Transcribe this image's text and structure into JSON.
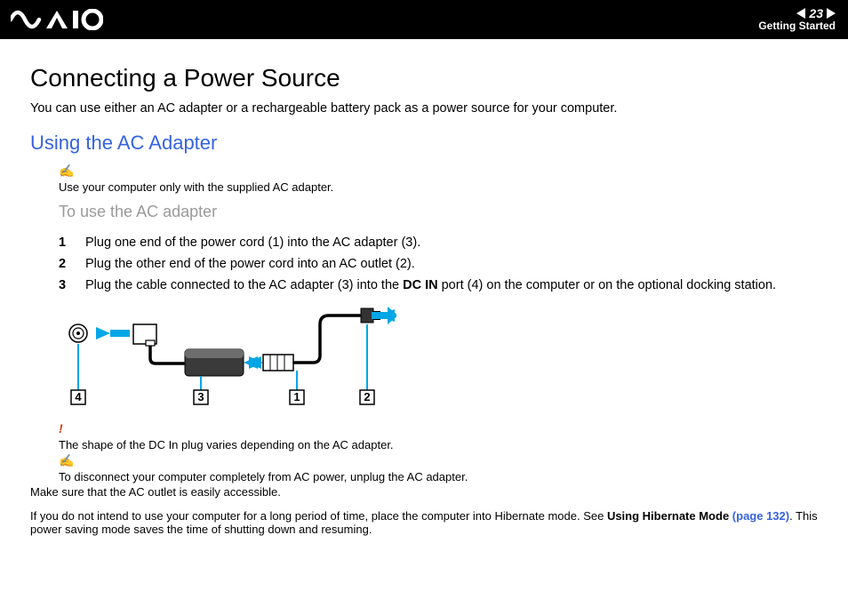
{
  "header": {
    "page_number": "23",
    "section": "Getting Started"
  },
  "title": "Connecting a Power Source",
  "intro": "You can use either an AC adapter or a rechargeable battery pack as a power source for your computer.",
  "subtitle": "Using the AC Adapter",
  "note1": "Use your computer only with the supplied AC adapter.",
  "sub_heading": "To use the AC adapter",
  "steps": [
    {
      "num": "1",
      "text": "Plug one end of the power cord (1) into the AC adapter (3)."
    },
    {
      "num": "2",
      "text": "Plug the other end of the power cord into an AC outlet (2)."
    },
    {
      "num": "3",
      "text_before": "Plug the cable connected to the AC adapter (3) into the ",
      "bold": "DC IN",
      "text_after": " port (4) on the computer or on the optional docking station."
    }
  ],
  "callouts": {
    "c1": "1",
    "c2": "2",
    "c3": "3",
    "c4": "4"
  },
  "warn": "The shape of the DC In plug varies depending on the AC adapter.",
  "note2": "To disconnect your computer completely from AC power, unplug the AC adapter.",
  "para1": "Make sure that the AC outlet is easily accessible.",
  "para2_before": "If you do not intend to use your computer for a long period of time, place the computer into Hibernate mode. See ",
  "para2_link_label": "Using Hibernate Mode ",
  "para2_link_page": "(page 132)",
  "para2_after": ". This power saving mode saves the time of shutting down and resuming."
}
